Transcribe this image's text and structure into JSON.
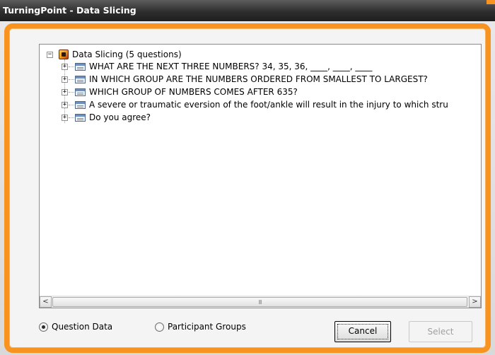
{
  "window": {
    "title": "TurningPoint - Data Slicing"
  },
  "tree": {
    "root_label": "Data Slicing (5 questions)",
    "questions": [
      "WHAT ARE THE NEXT THREE NUMBERS?  34, 35, 36, ____, ____, ____",
      "IN WHICH GROUP ARE THE NUMBERS ORDERED FROM SMALLEST TO LARGEST?",
      "WHICH GROUP OF NUMBERS COMES AFTER 635?",
      "A severe or traumatic eversion of the foot/ankle will result in the injury to which stru",
      "Do you agree?"
    ]
  },
  "scrollbar": {
    "left_arrow": "<",
    "right_arrow": ">",
    "grip": "III"
  },
  "options": {
    "question_data": "Question Data",
    "participant_groups": "Participant Groups",
    "selected": "question_data"
  },
  "buttons": {
    "cancel": "Cancel",
    "select": "Select"
  },
  "colors": {
    "accent": "#f7931e",
    "titlebar": "#2e2e2e"
  }
}
